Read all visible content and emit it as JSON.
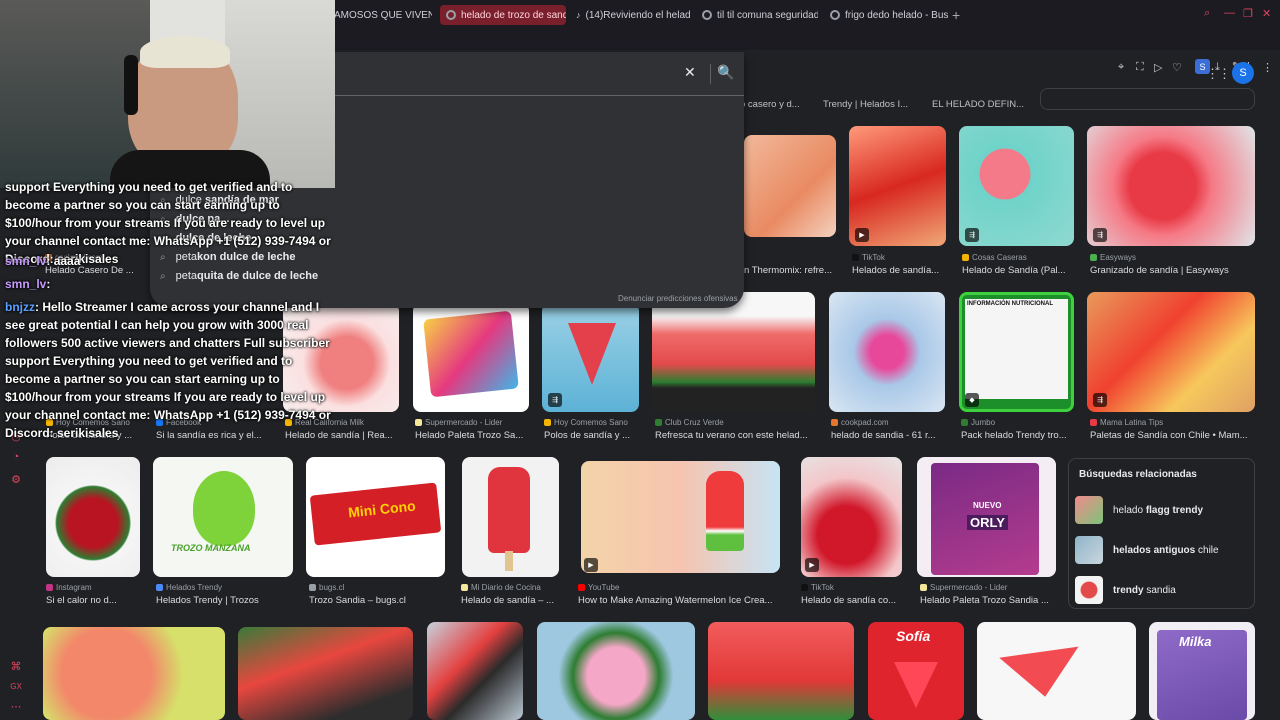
{
  "tabs": [
    {
      "label": "AMOSOS QUE VIVEN EN",
      "active": false
    },
    {
      "label": "helado de trozo de sandía",
      "active": true
    },
    {
      "label": "(14)Reviviendo el helado F",
      "active": false
    },
    {
      "label": "til til comuna seguridad - E",
      "active": false
    },
    {
      "label": "frigo dedo helado - Buscar",
      "active": false
    }
  ],
  "toolbar": {
    "new_tab": "+",
    "profile": "S",
    "ai": "AI"
  },
  "header": {
    "avatar": "S"
  },
  "search": {
    "clear_icon": "✕",
    "lens_icon": "🔍",
    "report": "Denunciar predicciones ofensivas",
    "suggestions": [
      {
        "plain": "dulce ",
        "bold": "sandía de mar"
      },
      {
        "plain": "",
        "bold": "dulce pa..."
      },
      {
        "plain": "",
        "bold": "dulce de leche"
      },
      {
        "plain": "peta",
        "bold": "kon dulce de leche"
      },
      {
        "plain": "peta",
        "bold": "quita de dulce de leche"
      }
    ]
  },
  "chat": {
    "msg1": "support Everything you need to get verified and to become a partner so you can start earning up to $100/hour from your streams If you are ready to level up your channel contact me: WhatsApp +1 (512) 939-7494 or Discord: serikisales",
    "user2": "smn_lv",
    "msg2": ": aaaa",
    "user3": "smn_lv",
    "msg3": ":",
    "user4": "bnjzz",
    "msg4": ": Hello Streamer I came across your channel and I see great potential I can help you grow with 3000 real followers 500 active viewers and chatters Full subscriber support Everything you need to get verified and to become a partner so you can start earning up to $100/hour from your streams If you are ready to level up your channel contact me: WhatsApp +1 (512) 939-7494 or Discord: serikisales"
  },
  "top_row": [
    "o casero y d...",
    "Trendy | Helados I...",
    "EL HELADO DEFIN..."
  ],
  "row1": [
    {
      "src": "cookpad.com",
      "title": "Helado Casero De ..."
    },
    {
      "src": "",
      "title": "n Thermomix: refre..."
    },
    {
      "src": "TikTok",
      "title": "Helados de sandía..."
    },
    {
      "src": "Cosas Caseras",
      "title": "Helado de Sandía (Pal..."
    },
    {
      "src": "Easyways",
      "title": "Granizado de sandía | Easyways"
    }
  ],
  "row2": [
    {
      "src": "Hoy Comemos Sano",
      "title": "Polos de sandía y ..."
    },
    {
      "src": "Facebook",
      "title": "Si la sandía es rica y el..."
    },
    {
      "src": "Real California Milk",
      "title": "Helado de sandía | Rea..."
    },
    {
      "src": "Supermercado - Lider",
      "title": "Helado Paleta Trozo Sa..."
    },
    {
      "src": "Hoy Comemos Sano",
      "title": "Polos de sandía y ..."
    },
    {
      "src": "Club Cruz Verde",
      "title": "Refresca tu verano con este helad..."
    },
    {
      "src": "cookpad.com",
      "title": "helado de sandia - 61 r..."
    },
    {
      "src": "Jumbo",
      "title": "Pack helado Trendy tro..."
    },
    {
      "src": "Mama Latina Tips",
      "title": "Paletas de Sandía con Chile • Mam..."
    }
  ],
  "row3": [
    {
      "src": "Instagram",
      "title": "Si el calor no d..."
    },
    {
      "src": "Helados Trendy",
      "title": "Helados Trendy | Trozos"
    },
    {
      "src": "bugs.cl",
      "title": "Trozo Sandia – bugs.cl"
    },
    {
      "src": "Mi Diario de Cocina",
      "title": "Helado de sandía – ..."
    },
    {
      "src": "YouTube",
      "title": "How to Make Amazing Watermelon Ice Crea..."
    },
    {
      "src": "TikTok",
      "title": "Helado de sandía co..."
    },
    {
      "src": "Supermercado - Lider",
      "title": "Helado Paleta Trozo Sandia ..."
    }
  ],
  "image_text": {
    "info_nutricional": "INFORMACIÓN NUTRICIONAL",
    "mini_cono": "Mini Cono",
    "trozo_manzana": "TROZO MANZANA",
    "orly": "ORLY",
    "nuevo": "NUEVO",
    "sofia": "Sofía",
    "milka": "Milka"
  },
  "related": {
    "title": "Búsquedas relacionadas",
    "items": [
      {
        "bold1": "",
        "plain": "helado ",
        "bold": "flagg trendy"
      },
      {
        "bold1": "helados antiguos",
        "plain": " chile",
        "bold": ""
      },
      {
        "bold1": "trendy",
        "plain": " sandia",
        "bold": ""
      }
    ]
  },
  "left_nav": [
    "◷",
    "◔",
    "⚙",
    "⌘",
    "GX",
    "⋯"
  ]
}
